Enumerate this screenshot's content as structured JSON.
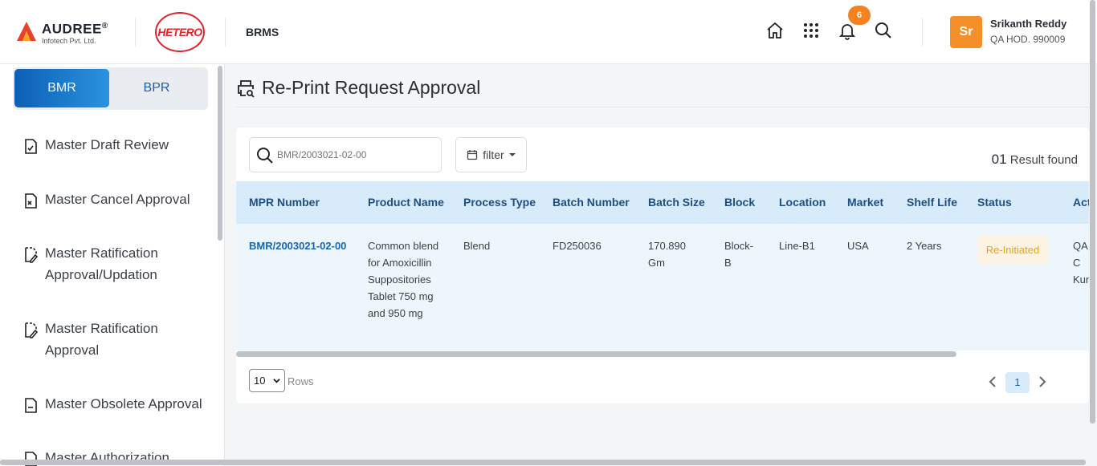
{
  "header": {
    "brand_name": "AUDREE",
    "brand_mark": "®",
    "brand_sub": "Infotech Pvt. Ltd.",
    "partner_logo": "HETERO",
    "app_name": "BRMS",
    "notifications_count": "6",
    "user": {
      "initials": "Sr",
      "name": "Srikanth Reddy",
      "role": "QA HOD. 990009"
    },
    "icons": [
      "home-icon",
      "apps-grid-icon",
      "bell-icon",
      "search-icon"
    ]
  },
  "sidebar": {
    "tabs": [
      {
        "label": "BMR",
        "active": true
      },
      {
        "label": "BPR",
        "active": false
      }
    ],
    "items": [
      {
        "label": "Master Draft Review",
        "icon": "doc-check-icon"
      },
      {
        "label": "Master Cancel Approval",
        "icon": "doc-cancel-icon"
      },
      {
        "label": "Master Ratification Approval/Updation",
        "icon": "doc-edit-icon"
      },
      {
        "label": "Master Ratification Approval",
        "icon": "doc-edit-icon"
      },
      {
        "label": "Master Obsolete Approval",
        "icon": "doc-minus-icon"
      },
      {
        "label": "Master Authorization",
        "icon": "doc-icon"
      }
    ]
  },
  "page": {
    "title": "Re-Print Request Approval",
    "search": {
      "placeholder": "BMR/2003021-02-00",
      "value": ""
    },
    "filter_label": "filter",
    "result_count": "01",
    "result_suffix": "Result found",
    "columns": [
      "MPR Number",
      "Product Name",
      "Process Type",
      "Batch Number",
      "Batch Size",
      "Block",
      "Location",
      "Market",
      "Shelf Life",
      "Status",
      "Acti"
    ],
    "rows": [
      {
        "mpr_number": "BMR/2003021-02-00",
        "product_name": "Common blend for Amoxicillin Suppositories Tablet 750 mg and 950 mg",
        "process_type": "Blend",
        "batch_number": "FD250036",
        "batch_size": "170.890 Gm",
        "block": "Block-B",
        "location": "Line-B1",
        "market": "USA",
        "shelf_life": "2 Years",
        "status": "Re-Initiated",
        "action": "QA C Kun"
      }
    ],
    "rows_per_page": "10",
    "rows_label": "Rows",
    "current_page": "1"
  },
  "colors": {
    "primary": "#0d5fb6",
    "accent": "#f58220",
    "status_reinitiated": "#e8a317",
    "header_row": "#d7ebfb"
  }
}
